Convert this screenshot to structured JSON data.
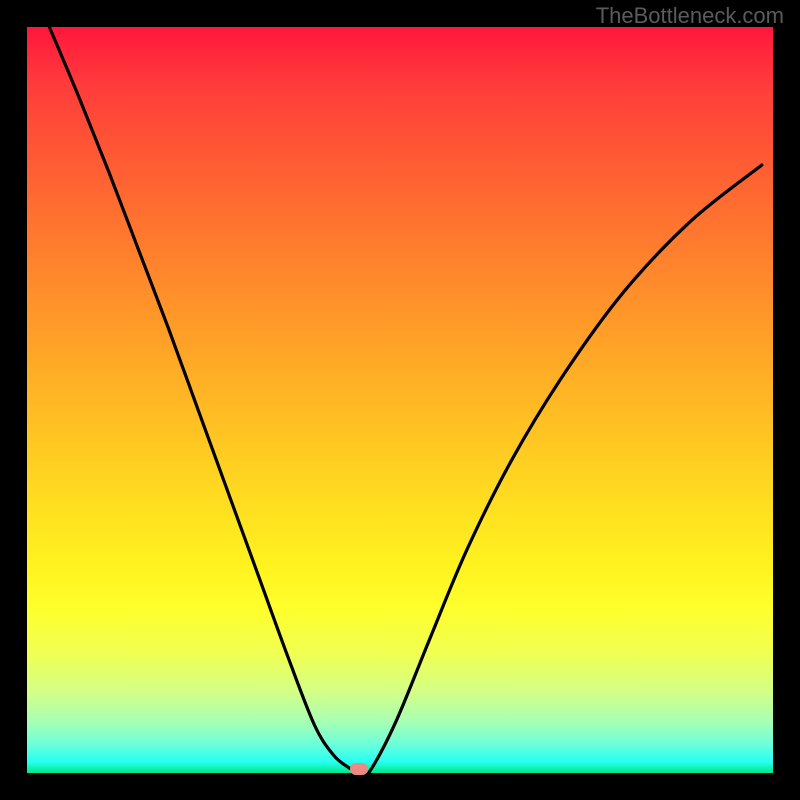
{
  "watermark": "TheBottleneck.com",
  "chart_data": {
    "type": "line",
    "title": "",
    "xlabel": "",
    "ylabel": "",
    "x_range": [
      0,
      1
    ],
    "y_range": [
      0,
      1
    ],
    "grid": false,
    "series": [
      {
        "name": "curve",
        "x": [
          0.03,
          0.07,
          0.11,
          0.15,
          0.19,
          0.23,
          0.27,
          0.31,
          0.35,
          0.385,
          0.41,
          0.43,
          0.445,
          0.45,
          0.46,
          0.495,
          0.54,
          0.59,
          0.65,
          0.72,
          0.8,
          0.89,
          0.985
        ],
        "y": [
          1.0,
          0.905,
          0.805,
          0.7,
          0.595,
          0.485,
          0.375,
          0.265,
          0.155,
          0.065,
          0.025,
          0.008,
          0.0,
          0.0,
          0.003,
          0.07,
          0.18,
          0.3,
          0.42,
          0.535,
          0.645,
          0.74,
          0.815
        ]
      }
    ],
    "marker": {
      "x": 0.445,
      "y": 0.0
    },
    "background_gradient": {
      "top": "#ff173d",
      "mid": "#ffd722",
      "bottom": "#00e885"
    },
    "colors": {
      "curve": "#000000",
      "marker": "#ed8b82",
      "frame": "#000000"
    }
  }
}
